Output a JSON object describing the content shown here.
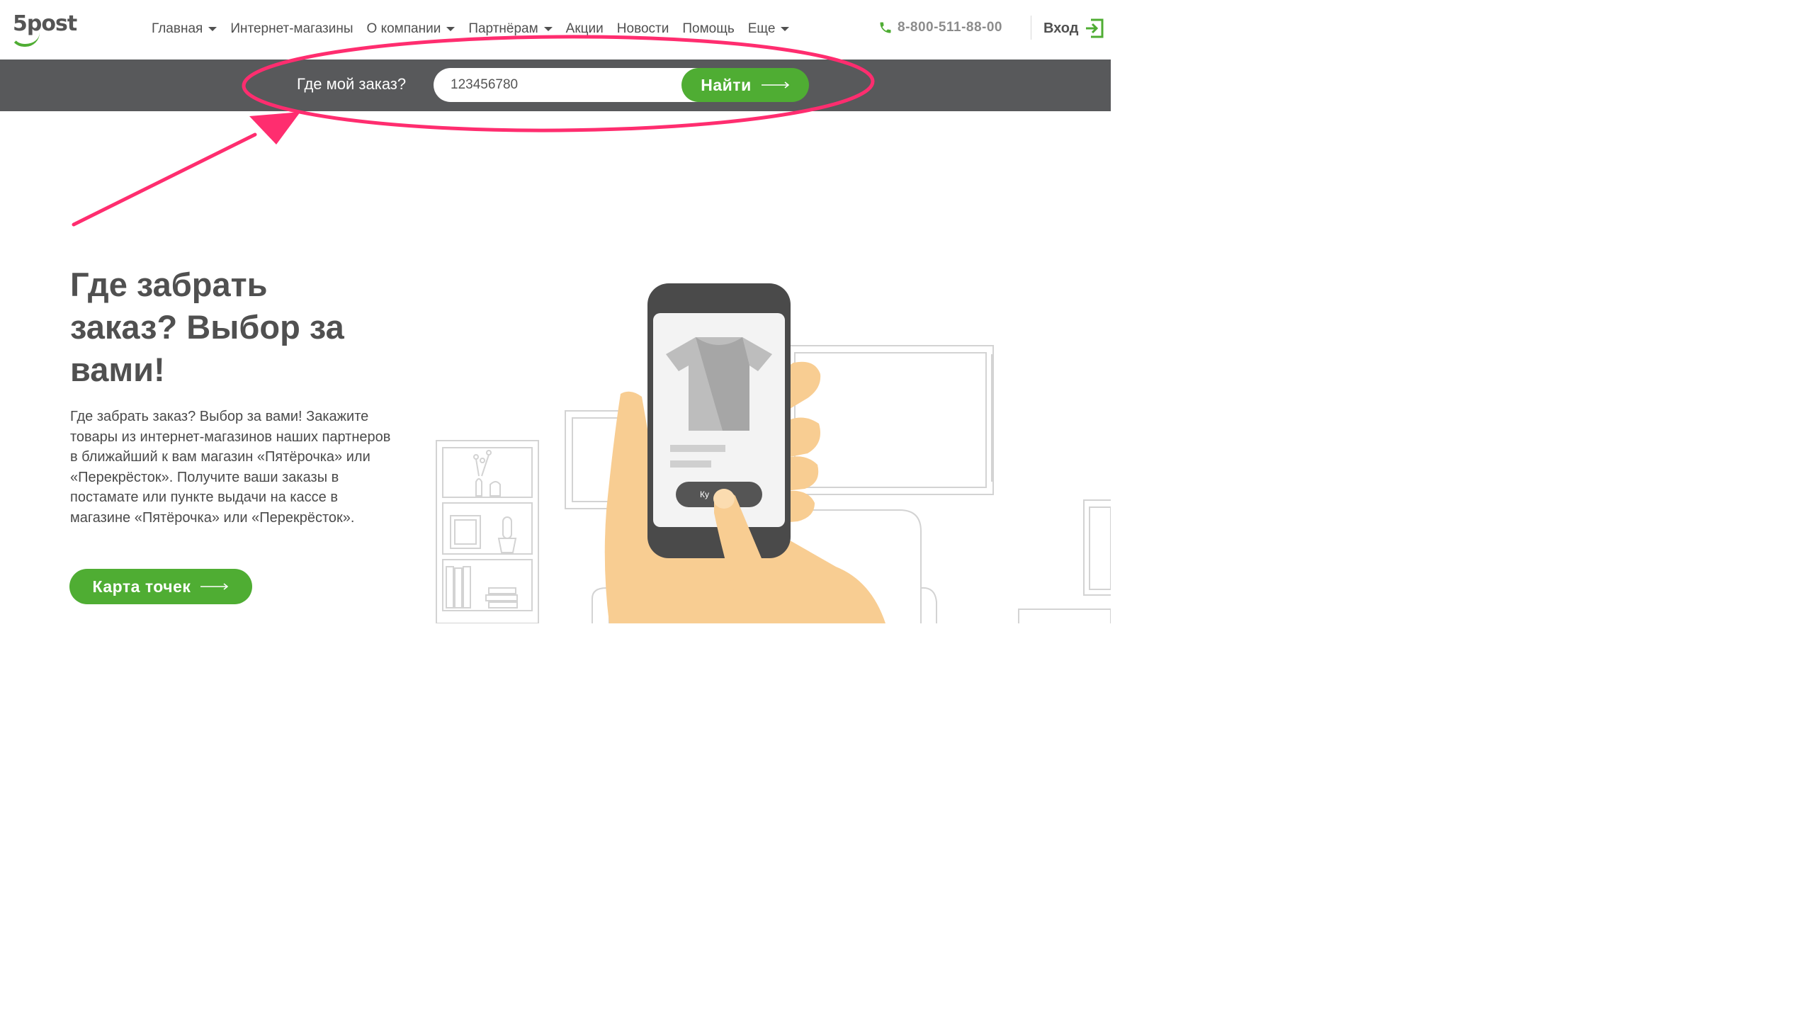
{
  "header": {
    "logo_text": "5post",
    "nav": [
      {
        "label": "Главная",
        "has_caret": true
      },
      {
        "label": "Интернет-магазины",
        "has_caret": false
      },
      {
        "label": "О компании",
        "has_caret": true
      },
      {
        "label": "Партнёрам",
        "has_caret": true
      },
      {
        "label": "Акции",
        "has_caret": false
      },
      {
        "label": "Новости",
        "has_caret": false
      },
      {
        "label": "Помощь",
        "has_caret": false
      },
      {
        "label": "Еще",
        "has_caret": true
      }
    ],
    "phone": "8-800-511-88-00",
    "phone_icon": "phone-icon",
    "login_label": "Вход",
    "login_icon": "login-icon"
  },
  "tracking": {
    "label": "Где мой заказ?",
    "input_value": "123456780",
    "button_label": "Найти"
  },
  "hero": {
    "title": "Где забрать заказ? Выбор за вами!",
    "text": "Где забрать заказ? Выбор за вами! Закажите товары из интернет-магазинов наших партнеров в ближайший к вам магазин «Пятёрочка» или «Перекрёсток». Получите ваши заказы в постамате или пункте выдачи на кассе в магазине «Пятёрочка» или «Перекрёсток».",
    "map_button": "Карта точек"
  },
  "illustration": {
    "phone_button_text": "Ку"
  },
  "colors": {
    "brand_green": "#4fad33",
    "track_bar": "#58595b",
    "annotation": "#ff2d6f",
    "text_dark": "#505050"
  }
}
